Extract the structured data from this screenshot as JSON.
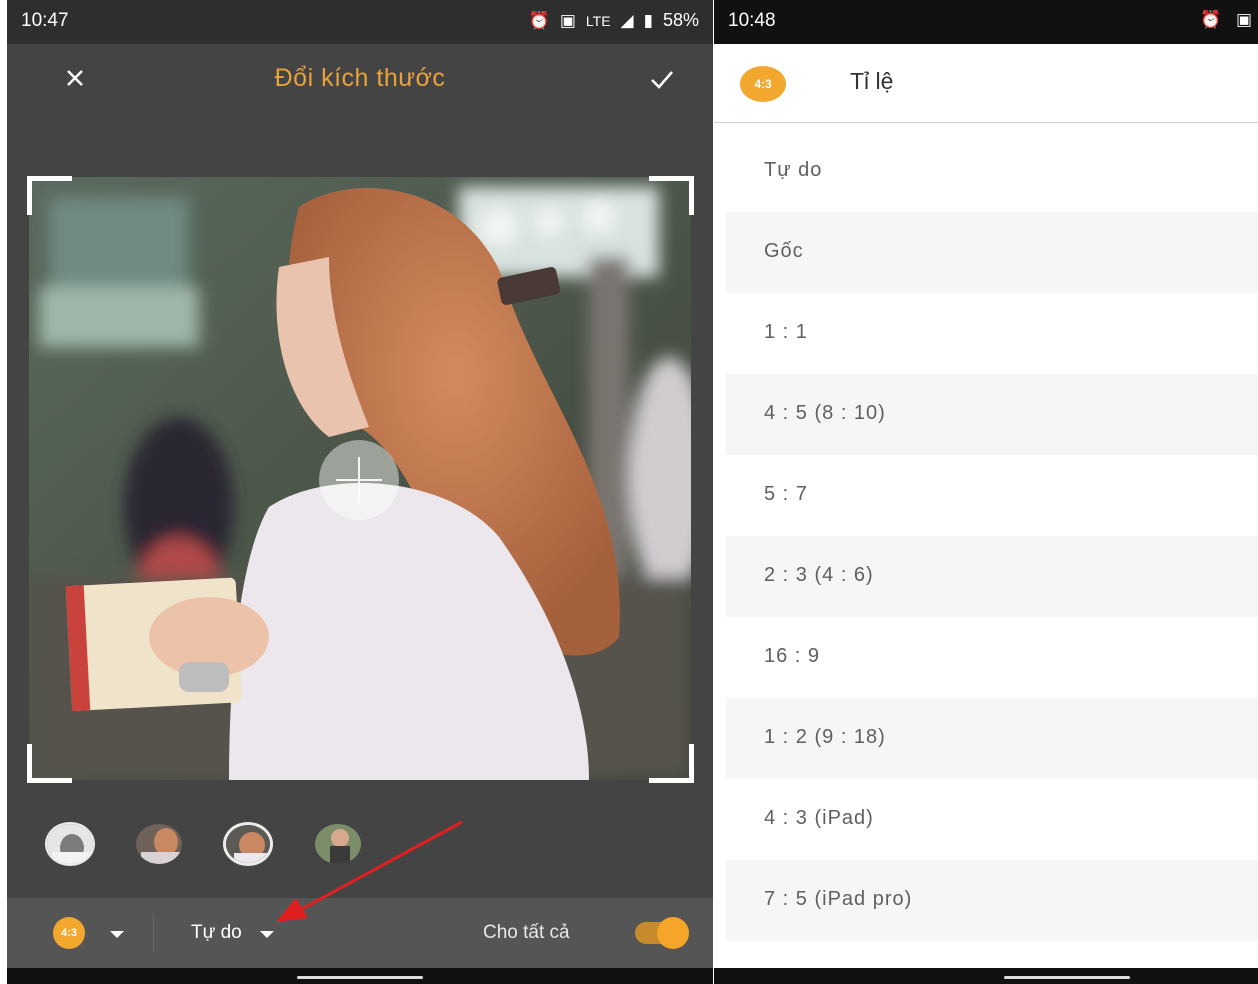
{
  "left": {
    "status": {
      "time": "10:47",
      "network": "LTE",
      "battery": "58%"
    },
    "title": "Đổi kích thước",
    "aspect_badge": "4:3",
    "ratio_selected": "Tự do",
    "apply_all_label": "Cho tất cả",
    "apply_all_on": true,
    "thumbnails": [
      "photo-1",
      "photo-2",
      "photo-3",
      "photo-4"
    ]
  },
  "right": {
    "status": {
      "time": "10:48"
    },
    "badge": "4:3",
    "title": "Tỉ lệ",
    "options": [
      "Tự do",
      "Gốc",
      "1 : 1",
      "4 : 5 (8 : 10)",
      "5 : 7",
      "2 : 3 (4 : 6)",
      "16 : 9",
      "1 : 2 (9 : 18)",
      "4 : 3 (iPad)",
      "7 : 5 (iPad pro)"
    ]
  },
  "colors": {
    "accent": "#f2a72e",
    "annotation_arrow": "#e02020"
  }
}
